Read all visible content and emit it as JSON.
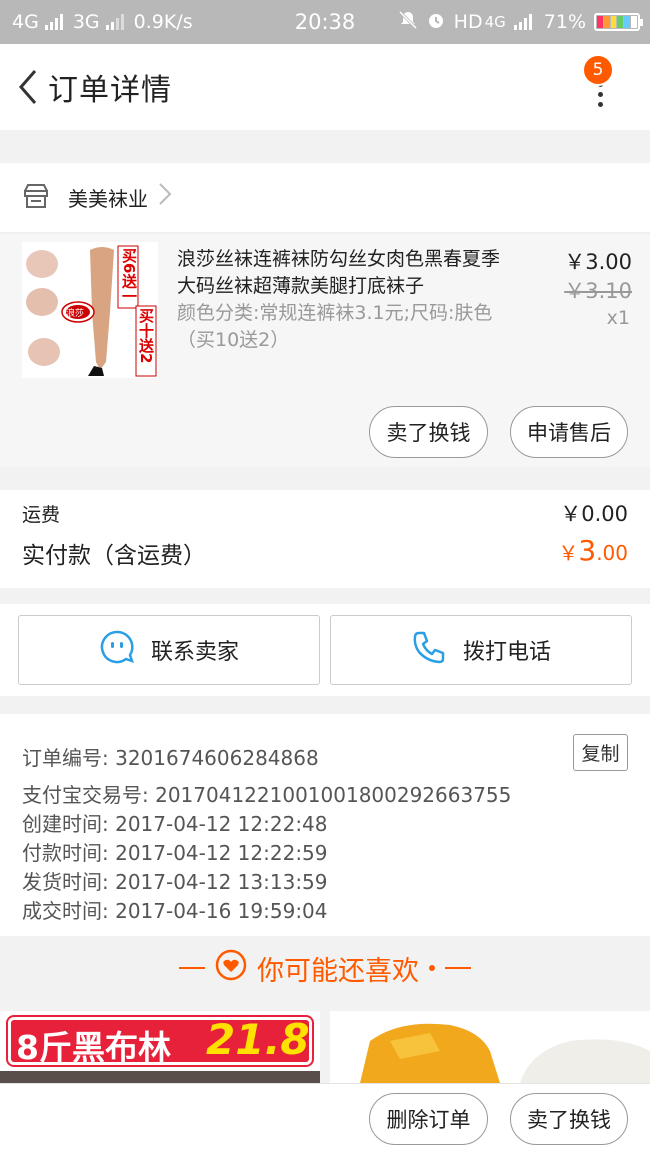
{
  "status_bar": {
    "net1": "4G",
    "net2": "3G",
    "speed": "0.9K/s",
    "time": "20:38",
    "hd": "HD",
    "net3": "4G",
    "battery": "71%"
  },
  "header": {
    "title": "订单详情",
    "badge": "5"
  },
  "shop": {
    "name": "美美袜业"
  },
  "product": {
    "title": "浪莎丝袜连裤袜防勾丝女肉色黑春夏季大码丝袜超薄款美腿打底袜子",
    "sku": "颜色分类:常规连裤袜3.1元;尺码:肤色（买10送2）",
    "price": "￥3.00",
    "original_price": "￥3.10",
    "quantity": "x1",
    "thumb_text_1": "买6送一",
    "thumb_text_2": "买十送2",
    "thumb_brand": "浪莎",
    "refund_label": "卖了换钱",
    "aftersale_label": "申请售后"
  },
  "fee": {
    "shipping_label": "运费",
    "shipping_value": "￥0.00",
    "paid_label": "实付款（含运费）",
    "paid_currency": "￥",
    "paid_int": "3",
    "paid_dec": ".00"
  },
  "contact": {
    "seller_label": "联系卖家",
    "phone_label": "拨打电话"
  },
  "order_info": {
    "order_no": "订单编号: 3201674606284868",
    "copy_label": "复制",
    "alipay_no": "支付宝交易号: 2017041221001001800292663755",
    "created": "创建时间: 2017-04-12 12:22:48",
    "paid": "付款时间: 2017-04-12 12:22:59",
    "shipped": "发货时间: 2017-04-12 13:13:59",
    "completed": "成交时间: 2017-04-16 19:59:04"
  },
  "recommend": {
    "title": "你可能还喜欢",
    "item1_text": "8斤黑布林",
    "item1_price": "21.8"
  },
  "bottom_bar": {
    "delete_label": "删除订单",
    "sell_label": "卖了换钱"
  },
  "colors": {
    "accent": "#ff5a00",
    "contact_icon": "#2a9fe5"
  }
}
